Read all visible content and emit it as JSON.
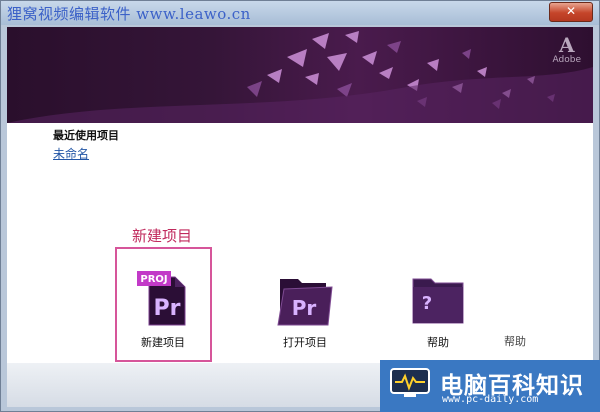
{
  "titlebar": {
    "watermark": "狸窝视频编辑软件 www.leawo.cn",
    "close_glyph": "✕"
  },
  "banner": {
    "adobe_mark": "A",
    "adobe_text": "Adobe"
  },
  "recent": {
    "heading": "最近使用项目",
    "items": [
      "未命名"
    ]
  },
  "annotation": {
    "label": "新建项目"
  },
  "actions": [
    {
      "label": "新建项目",
      "icon": "premiere-project-icon",
      "badge": "PROJ",
      "mark": "Pr"
    },
    {
      "label": "打开项目",
      "icon": "open-folder-icon",
      "mark": "Pr"
    },
    {
      "label": "帮助",
      "icon": "help-folder-icon",
      "mark": "?"
    }
  ],
  "ghost_text": "帮助",
  "brand_overlay": {
    "name": "电脑百科知识",
    "url": "www.pc-daily.com"
  },
  "colors": {
    "banner_dark": "#2a0f2c",
    "premiere_purple": "#3a1a4e",
    "accent_pink": "#c02a5d",
    "brand_blue": "#3a78c2"
  }
}
